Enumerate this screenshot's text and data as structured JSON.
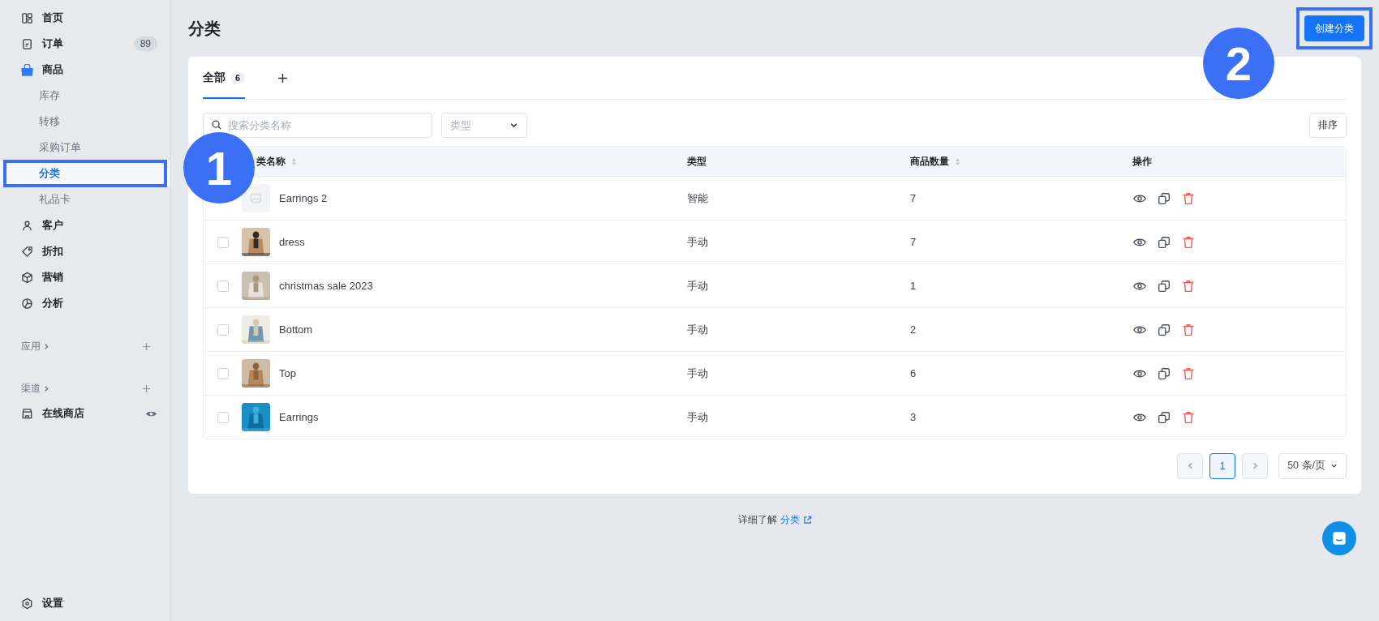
{
  "sidebar": {
    "items": [
      {
        "label": "首页",
        "selected": false
      },
      {
        "label": "订单",
        "badge": "89",
        "selected": false
      },
      {
        "label": "商品",
        "selected": false,
        "expanded": true,
        "children": [
          {
            "label": "库存",
            "selected": false
          },
          {
            "label": "转移",
            "selected": false
          },
          {
            "label": "采购订单",
            "selected": false
          },
          {
            "label": "分类",
            "selected": true
          },
          {
            "label": "礼品卡",
            "selected": false
          }
        ]
      },
      {
        "label": "客户",
        "selected": false
      },
      {
        "label": "折扣",
        "selected": false
      },
      {
        "label": "营销",
        "selected": false
      },
      {
        "label": "分析",
        "selected": false
      }
    ],
    "sections": [
      {
        "label": "应用"
      },
      {
        "label": "渠道",
        "items": [
          {
            "label": "在线商店",
            "selected": false
          }
        ]
      }
    ],
    "settings": {
      "label": "设置",
      "selected": false
    }
  },
  "page": {
    "title": "分类",
    "create_button": "创建分类"
  },
  "tabs": [
    {
      "label": "全部",
      "count": "6",
      "selected": true
    }
  ],
  "search": {
    "placeholder": "搜索分类名称"
  },
  "type_filter": {
    "placeholder": "类型"
  },
  "sort_button": "排序",
  "table": {
    "columns": [
      {
        "label": "类名称",
        "sortable": true
      },
      {
        "label": "类型",
        "sortable": false
      },
      {
        "label": "商品数量",
        "sortable": true
      },
      {
        "label": "操作",
        "sortable": false
      }
    ],
    "rows": [
      {
        "name": "Earrings 2",
        "type": "智能",
        "count": "7",
        "kind": "placeholder"
      },
      {
        "name": "dress",
        "type": "手动",
        "count": "7",
        "kind": "picture",
        "checked": false
      },
      {
        "name": "christmas sale 2023",
        "type": "手动",
        "count": "1",
        "kind": "picture",
        "checked": false
      },
      {
        "name": "Bottom",
        "type": "手动",
        "count": "2",
        "kind": "picture",
        "checked": false
      },
      {
        "name": "Top",
        "type": "手动",
        "count": "6",
        "kind": "picture",
        "checked": false
      },
      {
        "name": "Earrings",
        "type": "手动",
        "count": "3",
        "kind": "picture",
        "checked": false
      }
    ]
  },
  "pagination": {
    "pages": [
      {
        "label": "1",
        "selected": true
      }
    ],
    "page_size": "50 条/页"
  },
  "footer": {
    "text": "详细了解",
    "link": "分类"
  },
  "annotations": [
    {
      "number": "1"
    },
    {
      "number": "2"
    }
  ]
}
